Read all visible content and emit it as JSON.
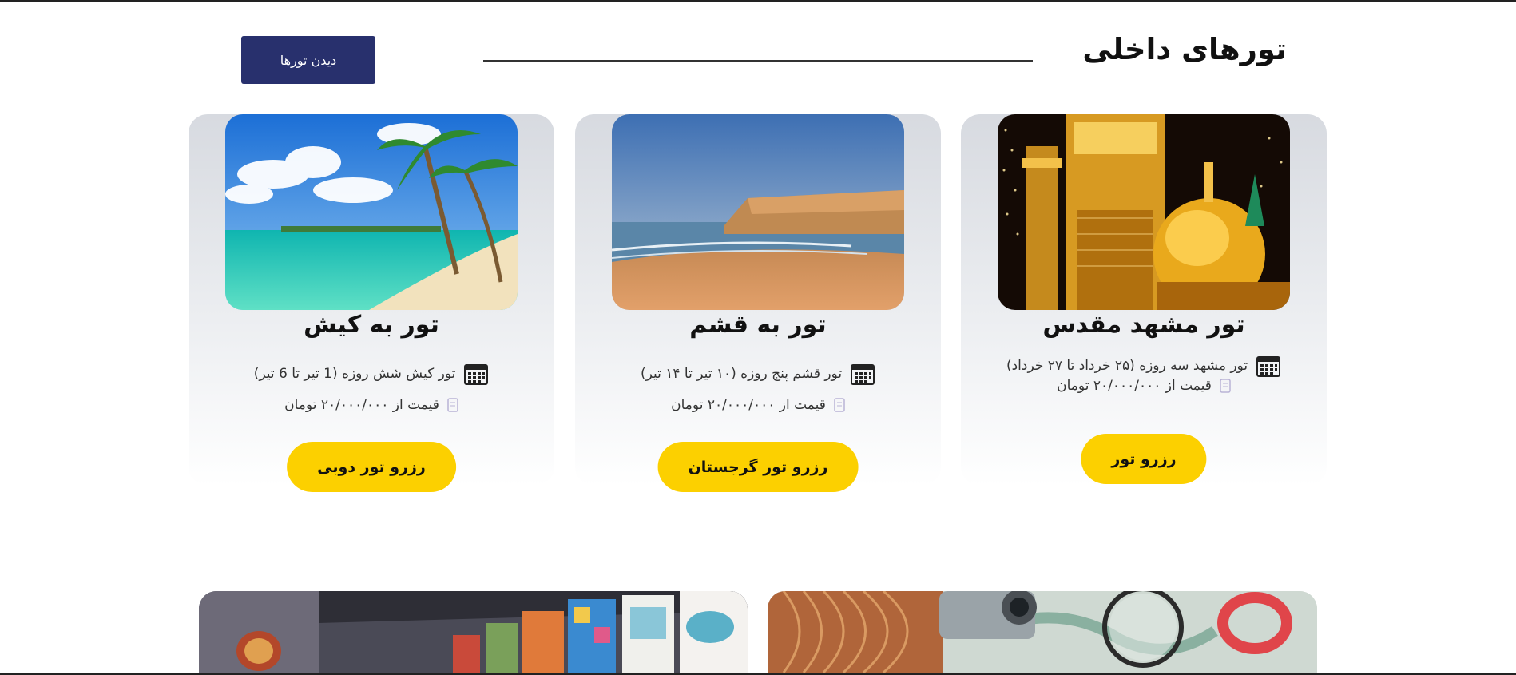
{
  "section": {
    "title": "تورهای داخلی",
    "view_button_label": "دیدن تورها"
  },
  "cards": [
    {
      "title": "تور مشهد مقدس",
      "details": "تور مشهد سه روزه (۲۵ خرداد تا ۲۷ خرداد)",
      "price": "قیمت از ۲۰/۰۰۰/۰۰۰ تومان",
      "button_label": "رزرو تور",
      "image": "mashhad-shrine-image"
    },
    {
      "title": "تور به قشم",
      "details": "تور قشم پنج روزه (۱۰ تیر تا ۱۴ تیر)",
      "price": "قیمت از ۲۰/۰۰۰/۰۰۰ تومان",
      "button_label": "رزرو تور گرجستان",
      "image": "qeshm-beach-cliff-image"
    },
    {
      "title": "تور به کیش",
      "details": "تور کیش شش روزه (1 تیر تا 6 تیر)",
      "price": "قیمت از ۲۰/۰۰۰/۰۰۰ تومان",
      "button_label": "رزرو تور دوبی",
      "image": "kish-tropical-beach-image"
    }
  ],
  "bottom_images": [
    "art-gallery-image",
    "travel-map-camera-image"
  ],
  "colors": {
    "primary_button": "#28306d",
    "accent_button": "#fcd000",
    "card_gradient_top": "#d7dae0"
  },
  "icons": [
    "calendar-icon",
    "document-icon"
  ]
}
